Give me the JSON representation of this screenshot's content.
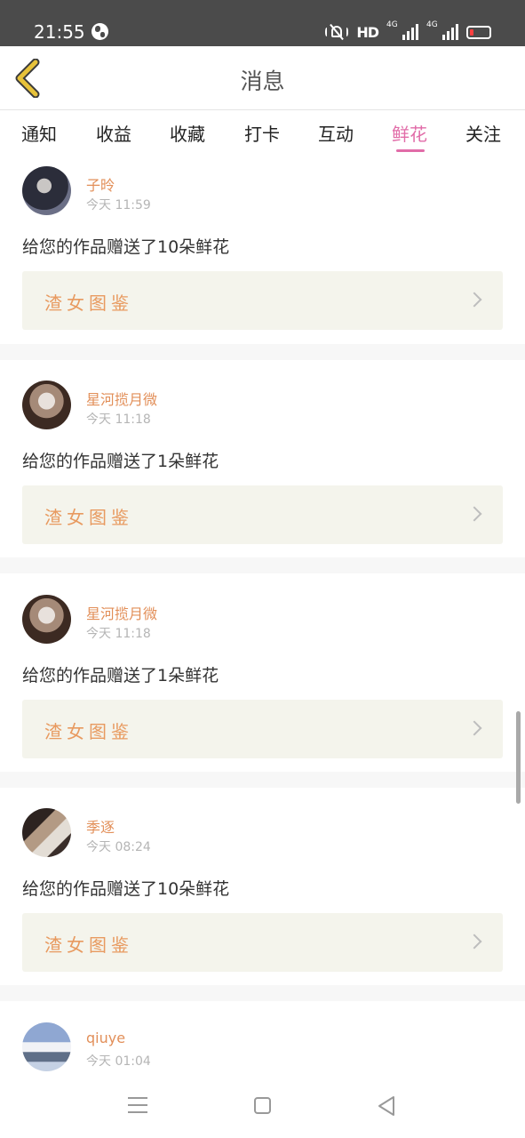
{
  "status_bar": {
    "time": "21:55",
    "network": "HD",
    "sim1": "4G",
    "sim2": "4G",
    "icons": [
      "globe-icon",
      "vibrate-mute-icon",
      "signal-icon",
      "battery-low-icon"
    ]
  },
  "header": {
    "title": "消息",
    "back_icon": "chevron-left-icon",
    "accent_color": "#e7c23a"
  },
  "tabs": [
    {
      "label": "通知"
    },
    {
      "label": "收益"
    },
    {
      "label": "收藏"
    },
    {
      "label": "打卡"
    },
    {
      "label": "互动"
    },
    {
      "label": "鲜花",
      "active": true
    },
    {
      "label": "关注"
    }
  ],
  "colors": {
    "active_tab": "#e16ca8",
    "username": "#e28f59",
    "work_title": "#e89a60",
    "work_card_bg": "#f4f4ec"
  },
  "messages": [
    {
      "user": "子昤",
      "time": "今天 11:59",
      "text": "给您的作品赠送了10朵鲜花",
      "work": "渣女图鉴"
    },
    {
      "user": "星河揽月微",
      "time": "今天 11:18",
      "text": "给您的作品赠送了1朵鲜花",
      "work": "渣女图鉴"
    },
    {
      "user": "星河揽月微",
      "time": "今天 11:18",
      "text": "给您的作品赠送了1朵鲜花",
      "work": "渣女图鉴"
    },
    {
      "user": "季逐",
      "time": "今天 08:24",
      "text": "给您的作品赠送了10朵鲜花",
      "work": "渣女图鉴"
    },
    {
      "user": "qiuye",
      "time": "今天 01:04"
    }
  ],
  "nav_bar": {
    "icons": [
      "menu-icon",
      "home-square-icon",
      "back-triangle-icon"
    ]
  }
}
